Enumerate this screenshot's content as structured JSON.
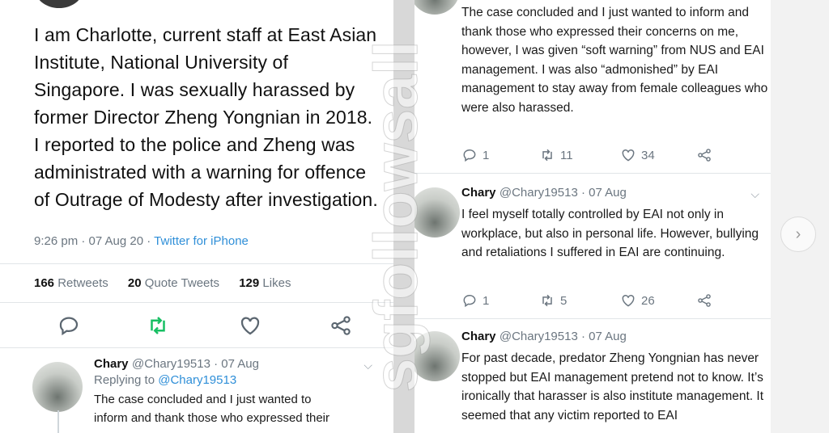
{
  "main_tweet": {
    "text": "I am Charlotte, current staff at East Asian Institute, National University of Singapore. I was sexually harassed by former Director Zheng Yongnian in 2018. I reported to the police and Zheng was administrated with a warning for offence of Outrage of Modesty after investigation.",
    "time": "9:26 pm · 07 Aug 20 · ",
    "source": "Twitter for iPhone",
    "retweets_count": "166",
    "retweets_label": "Retweets",
    "quotes_count": "20",
    "quotes_label": "Quote Tweets",
    "likes_count": "129",
    "likes_label": "Likes"
  },
  "reply_tweet": {
    "name": "Chary",
    "handle": "@Chary19513 · 07 Aug",
    "replying_prefix": "Replying to ",
    "replying_handle": "@Chary19513",
    "line1": "The case concluded and I just wanted to",
    "line2": "inform and thank those who expressed their"
  },
  "right_tweets": [
    {
      "text": "The case concluded and I just wanted to inform and thank those who expressed their concerns on me, however, I was given “soft warning” from NUS and EAI management. I was also “admonished” by EAI management to stay away from female colleagues who were also harassed.",
      "replies": "1",
      "retweets": "11",
      "likes": "34"
    },
    {
      "name": "Chary",
      "handle": "@Chary19513 · 07 Aug",
      "text": "I feel myself totally controlled by EAI not only in workplace, but also in personal life. However, bullying and retaliations I suffered in EAI are continuing.",
      "replies": "1",
      "retweets": "5",
      "likes": "26"
    },
    {
      "name": "Chary",
      "handle": "@Chary19513 · 07 Aug",
      "text": "For past decade, predator Zheng Yongnian has never stopped but EAI management pretend not to know. It’s ironically that harasser is also institute management. It seemed that any victim reported to EAI"
    }
  ],
  "watermark_text": "sgfollowsall",
  "icons": {
    "reply": "reply-icon",
    "retweet": "retweet-icon",
    "like": "heart-icon",
    "share": "share-icon",
    "chevron": "chevron-down-icon",
    "next": "chevron-right-icon"
  },
  "colors": {
    "link": "#2f8fd8",
    "retweet_active": "#17bf63",
    "muted": "#6b7680"
  }
}
